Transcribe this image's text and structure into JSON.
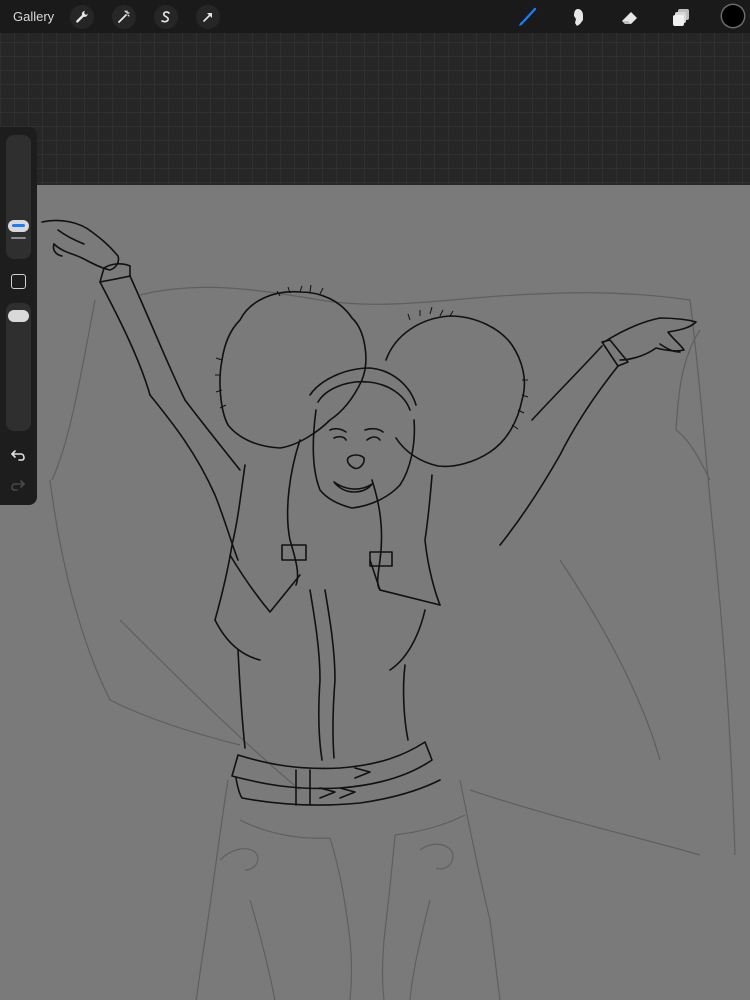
{
  "toolbar": {
    "gallery_label": "Gallery",
    "left_icons": [
      "wrench-icon",
      "magic-wand-icon",
      "selection-s-icon",
      "arrow-transform-icon"
    ],
    "right_icons": [
      "brush-icon",
      "smudge-icon",
      "eraser-icon",
      "layers-icon"
    ],
    "active_tool": "brush-icon",
    "accent_color": "#1a7cff",
    "current_color": "#000000"
  },
  "sidebar": {
    "brush_size": 0.3,
    "brush_opacity": 1.0,
    "icons": [
      "modify-square-icon",
      "undo-icon",
      "redo-icon"
    ]
  },
  "canvas": {
    "background_color": "#7a7a7a"
  }
}
